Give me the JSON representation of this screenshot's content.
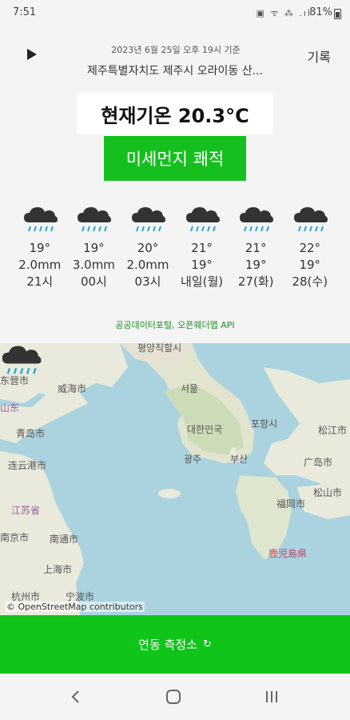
{
  "status_bar": {
    "time": "7:51",
    "icons": "▣ ᯤ ⁂ .ıl",
    "battery": "81%"
  },
  "header": {
    "play_icon": "play-icon",
    "timestamp": "2023년 6월 25일 오후 19시 기준",
    "location": "제주특별자치도 제주시 오라이동 산...",
    "record_label": "기록"
  },
  "current": {
    "temperature": "현재기온 20.3°C",
    "dust": "미세먼지 쾌적",
    "dust_color": "#15c01e"
  },
  "forecast": [
    {
      "icon": "rain-cloud-icon",
      "temp": "19°",
      "precip": "2.0mm",
      "time": "21시"
    },
    {
      "icon": "rain-cloud-icon",
      "temp": "19°",
      "precip": "3.0mm",
      "time": "00시"
    },
    {
      "icon": "rain-cloud-icon",
      "temp": "20°",
      "precip": "2.0mm",
      "time": "03시"
    },
    {
      "icon": "rain-cloud-icon",
      "temp": "21°",
      "precip": "19°",
      "time": "내일(월)"
    },
    {
      "icon": "rain-cloud-icon",
      "temp": "21°",
      "precip": "19°",
      "time": "27(화)"
    },
    {
      "icon": "rain-cloud-icon",
      "temp": "22°",
      "precip": "19°",
      "time": "28(수)"
    }
  ],
  "credit": "공공데이터포털, 오픈웨더맵 API",
  "map": {
    "labels": [
      {
        "text": "평양직할시"
      },
      {
        "text": "东营市"
      },
      {
        "text": "威海市"
      },
      {
        "text": "山东"
      },
      {
        "text": "서울"
      },
      {
        "text": "青岛市"
      },
      {
        "text": "대한민국"
      },
      {
        "text": "포항시"
      },
      {
        "text": "松江市"
      },
      {
        "text": "连云港市"
      },
      {
        "text": "광주"
      },
      {
        "text": "부산"
      },
      {
        "text": "广岛市"
      },
      {
        "text": "江苏省"
      },
      {
        "text": "福岡市"
      },
      {
        "text": "松山市"
      },
      {
        "text": "南京市"
      },
      {
        "text": "南通市"
      },
      {
        "text": "鹿児島県"
      },
      {
        "text": "上海市"
      },
      {
        "text": "杭州市"
      },
      {
        "text": "宁波市"
      }
    ],
    "attribution": "© OpenStreetMap contributors",
    "marker_icon": "rain-cloud-icon"
  },
  "bottom_button": {
    "label": "연동 측정소",
    "icon": "loading-icon",
    "glyph": "↻"
  },
  "nav": {
    "back": "back-icon",
    "home": "home-icon",
    "recent": "recent-apps-icon"
  }
}
